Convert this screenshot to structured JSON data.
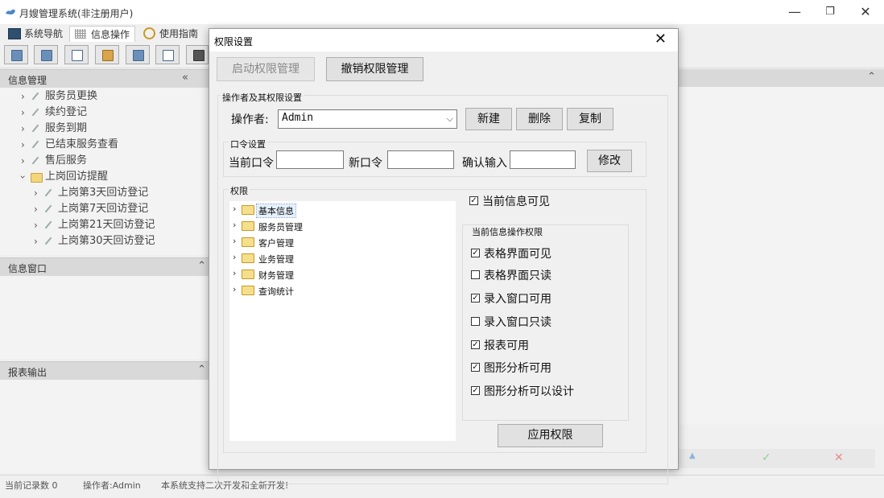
{
  "app": {
    "title": "月嫂管理系统(非注册用户)"
  },
  "window_controls": {
    "minimize": "—",
    "maximize": "❐",
    "close": "✕"
  },
  "main_tabs": [
    {
      "label": "系统导航",
      "icon": "window-icon"
    },
    {
      "label": "信息操作",
      "icon": "grid-icon"
    },
    {
      "label": "使用指南",
      "icon": "help-circle-icon"
    }
  ],
  "left": {
    "info_panel": {
      "title": "信息管理",
      "collapse": "«",
      "items": [
        {
          "label": "服务员更换",
          "level": 1,
          "icon": "tool-icon"
        },
        {
          "label": "续约登记",
          "level": 1,
          "icon": "tool-icon"
        },
        {
          "label": "服务到期",
          "level": 1,
          "icon": "tool-icon"
        },
        {
          "label": "已结束服务查看",
          "level": 1,
          "icon": "tool-icon"
        },
        {
          "label": "售后服务",
          "level": 1,
          "icon": "tool-icon"
        },
        {
          "label": "上岗回访提醒",
          "level": 1,
          "icon": "folder-icon",
          "expanded": true
        },
        {
          "label": "上岗第3天回访登记",
          "level": 2,
          "icon": "tool-icon"
        },
        {
          "label": "上岗第7天回访登记",
          "level": 2,
          "icon": "tool-icon"
        },
        {
          "label": "上岗第21天回访登记",
          "level": 2,
          "icon": "tool-icon"
        },
        {
          "label": "上岗第30天回访登记",
          "level": 2,
          "icon": "tool-icon"
        }
      ]
    },
    "info_window": {
      "title": "信息窗口",
      "btn": "⌃"
    },
    "report_output": {
      "title": "报表输出",
      "btn": "⌃"
    }
  },
  "right_panel": {
    "btn": "⌃"
  },
  "bottom_actions": {
    "up": "▲",
    "ok": "✓",
    "cancel": "✕"
  },
  "statusbar": {
    "record_count": "当前记录数 0",
    "operator": "操作者:Admin",
    "note": "本系统支持二次开发和全新开发!"
  },
  "dialog": {
    "title": "权限设置",
    "close": "✕",
    "enable_btn": "启动权限管理",
    "revoke_btn": "撤销权限管理",
    "operator_group": {
      "title": "操作者及其权限设置",
      "operator_label": "操作者:",
      "operator_value": "Admin",
      "new_btn": "新建",
      "delete_btn": "删除",
      "copy_btn": "复制"
    },
    "password_group": {
      "title": "口令设置",
      "current_label": "当前口令",
      "new_label": "新口令",
      "confirm_label": "确认输入",
      "current_value": "",
      "new_value": "",
      "confirm_value": "",
      "modify_btn": "修改"
    },
    "permissions": {
      "title": "权限",
      "tree": [
        {
          "label": "基本信息",
          "selected": true
        },
        {
          "label": "服务员管理",
          "selected": false
        },
        {
          "label": "客户管理",
          "selected": false
        },
        {
          "label": "业务管理",
          "selected": false
        },
        {
          "label": "财务管理",
          "selected": false
        },
        {
          "label": "查询统计",
          "selected": false
        }
      ],
      "visible_check": {
        "label": "当前信息可见",
        "checked": true
      },
      "ops_group_title": "当前信息操作权限",
      "ops": [
        {
          "label": "表格界面可见",
          "checked": true
        },
        {
          "label": "表格界面只读",
          "checked": false
        },
        {
          "label": "录入窗口可用",
          "checked": true
        },
        {
          "label": "录入窗口只读",
          "checked": false
        },
        {
          "label": "报表可用",
          "checked": true
        },
        {
          "label": "图形分析可用",
          "checked": true
        },
        {
          "label": "图形分析可以设计",
          "checked": true
        }
      ],
      "apply_btn": "应用权限"
    }
  }
}
